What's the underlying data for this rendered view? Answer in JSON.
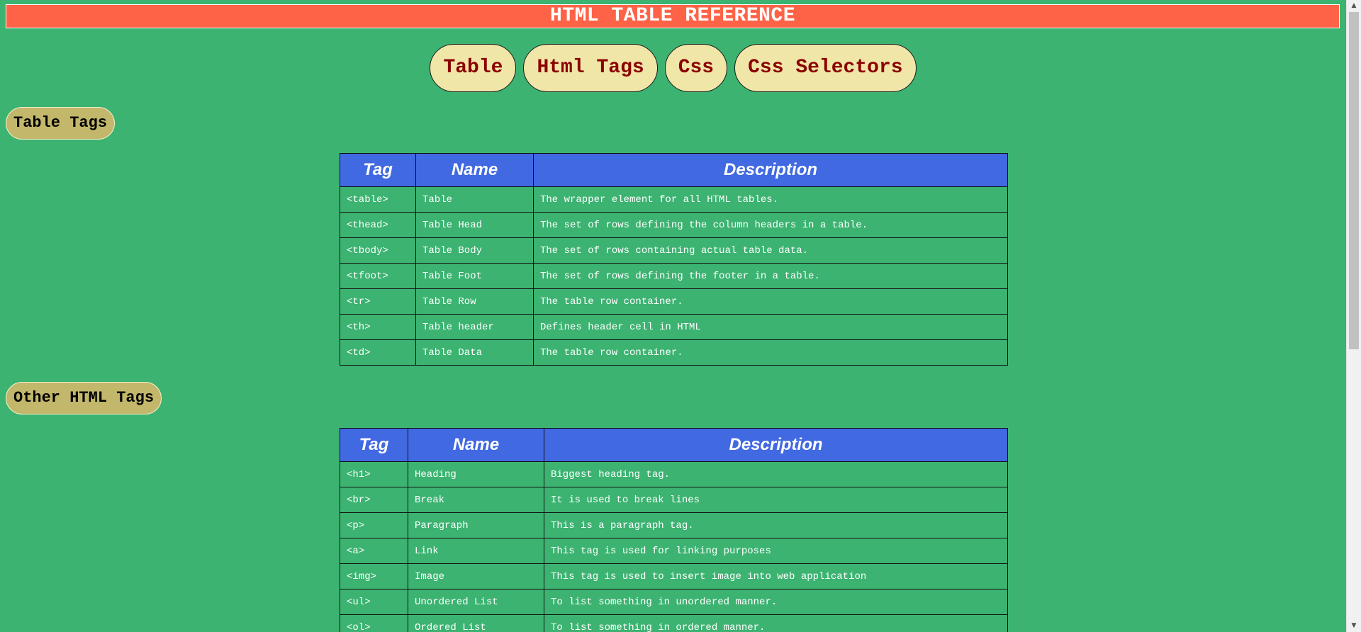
{
  "title": "HTML TABLE REFERENCE",
  "nav": {
    "buttons": [
      "Table",
      "Html Tags",
      "Css",
      "Css Selectors"
    ]
  },
  "sections": [
    {
      "heading": "Table Tags",
      "columns": [
        "Tag",
        "Name",
        "Description"
      ],
      "rows": [
        [
          "<table>",
          "Table",
          "The wrapper element for all HTML tables."
        ],
        [
          "<thead>",
          "Table Head",
          "The set of rows defining the column headers in a table."
        ],
        [
          "<tbody>",
          "Table Body",
          "The set of rows containing actual table data."
        ],
        [
          "<tfoot>",
          "Table Foot",
          "The set of rows defining the footer in a table."
        ],
        [
          "<tr>",
          "Table Row",
          "The table row container."
        ],
        [
          "<th>",
          "Table header",
          "Defines header cell in HTML"
        ],
        [
          "<td>",
          "Table Data",
          "The table row container."
        ]
      ]
    },
    {
      "heading": "Other HTML Tags",
      "columns": [
        "Tag",
        "Name",
        "Description"
      ],
      "rows": [
        [
          "<h1>",
          "Heading",
          "Biggest heading tag."
        ],
        [
          "<br>",
          "Break",
          "It is used to break lines"
        ],
        [
          "<p>",
          "Paragraph",
          "This is a paragraph tag."
        ],
        [
          "<a>",
          "Link",
          "This tag is used for linking purposes"
        ],
        [
          "<img>",
          "Image",
          "This tag is used to insert image into web application"
        ],
        [
          "<ul>",
          "Unordered List",
          "To list something in unordered manner."
        ],
        [
          "<ol>",
          "Ordered List",
          "To list something in ordered manner."
        ]
      ]
    }
  ],
  "colors": {
    "page_background": "#3cb371",
    "title_bar": "#ff6347",
    "nav_button": "#f0e6a8",
    "nav_text": "#8b0000",
    "section_pill": "#c2b76a",
    "table_header": "#4169e1"
  },
  "scrollbar": {
    "up_icon": "scroll-up-arrow-icon",
    "down_icon": "scroll-down-arrow-icon"
  }
}
